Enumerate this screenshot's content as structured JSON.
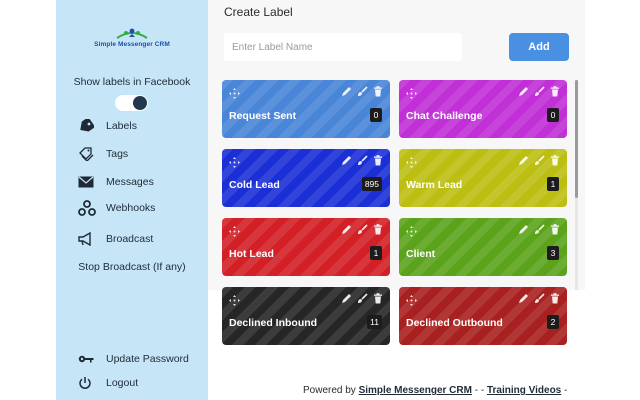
{
  "sidebar": {
    "logo_text": "Simple Messenger CRM",
    "show_labels_text": "Show labels in Facebook",
    "toggle_on": true,
    "nav": [
      {
        "label": "Labels",
        "icon": "tag-icon"
      },
      {
        "label": "Tags",
        "icon": "tags-icon"
      },
      {
        "label": "Messages",
        "icon": "envelope-icon"
      },
      {
        "label": "Webhooks",
        "icon": "webhook-icon"
      },
      {
        "label": "Broadcast",
        "icon": "megaphone-icon"
      },
      {
        "label": "Stop Broadcast (If any)",
        "icon": ""
      }
    ],
    "bottom": [
      {
        "label": "Update Password",
        "icon": "key-icon"
      },
      {
        "label": "Logout",
        "icon": "power-icon"
      }
    ]
  },
  "main": {
    "title": "Create Label",
    "input_placeholder": "Enter Label Name",
    "input_value": "",
    "add_label": "Add"
  },
  "labels": [
    {
      "name": "Request Sent",
      "count": "0",
      "color": "#4a86d8"
    },
    {
      "name": "Chat Challenge",
      "count": "0",
      "color": "#c12fd6"
    },
    {
      "name": "Cold Lead",
      "count": "895",
      "color": "#1b2fd6"
    },
    {
      "name": "Warm Lead",
      "count": "1",
      "color": "#bcbf12"
    },
    {
      "name": "Hot Lead",
      "count": "1",
      "color": "#d31f26"
    },
    {
      "name": "Client",
      "count": "3",
      "color": "#5ba31b"
    },
    {
      "name": "Declined Inbound",
      "count": "11",
      "color": "#262626"
    },
    {
      "name": "Declined Outbound",
      "count": "2",
      "color": "#a8201f"
    }
  ],
  "footer": {
    "powered_by": "Powered by",
    "crm_link": "Simple Messenger CRM",
    "sep1": " -  - ",
    "training_link": "Training Videos",
    "sep2": " -"
  }
}
